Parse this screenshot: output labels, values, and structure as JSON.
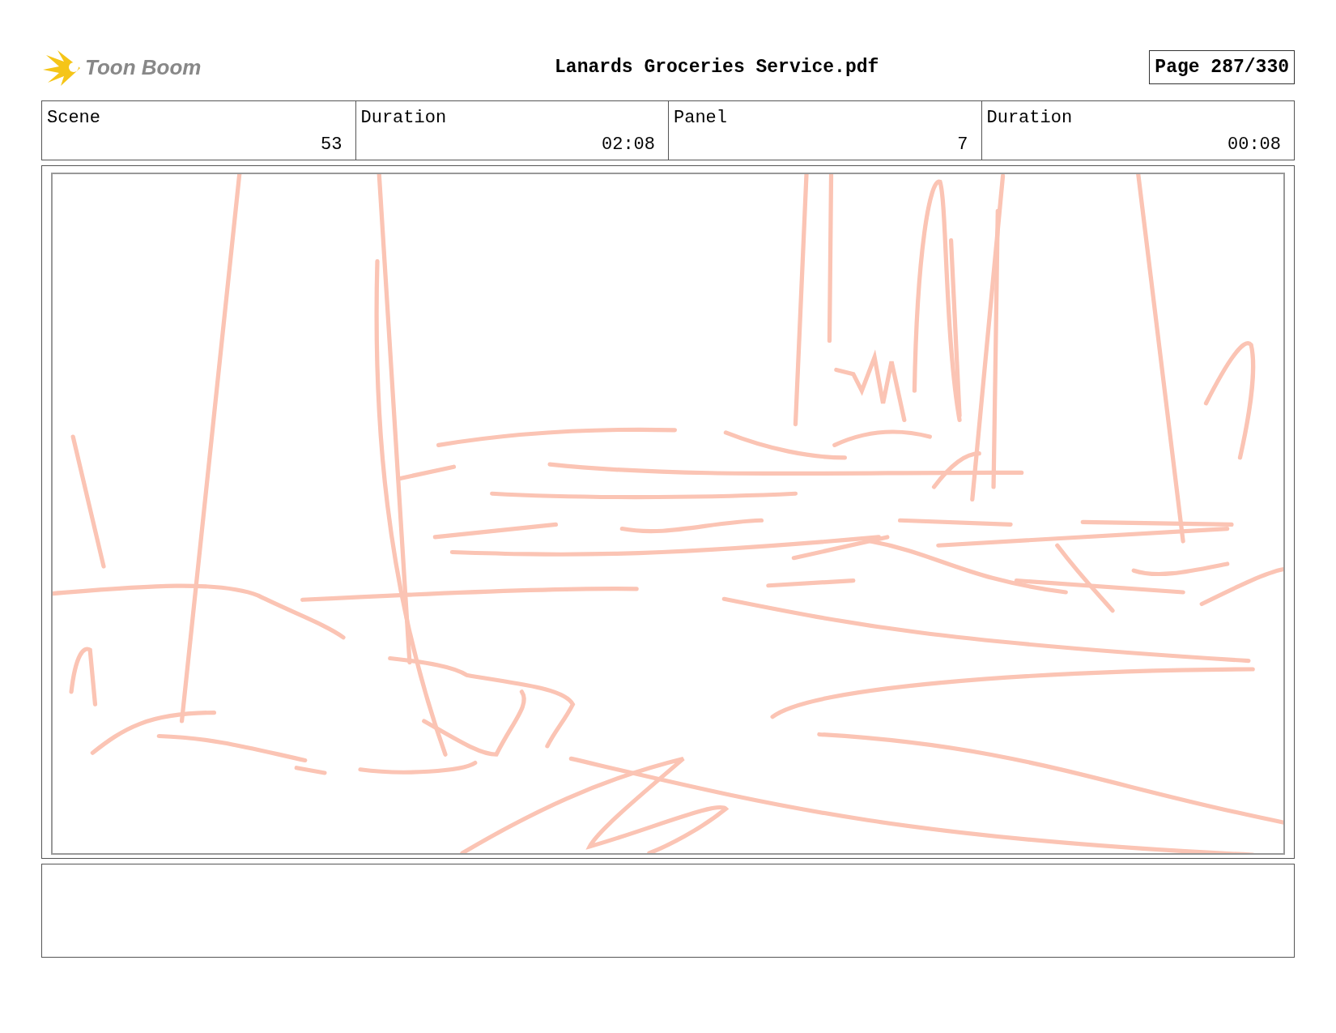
{
  "header": {
    "logo_text": "Toon Boom",
    "title": "Lanards Groceries Service.pdf",
    "page": "Page 287/330"
  },
  "info": [
    {
      "label": "Scene",
      "value": "53"
    },
    {
      "label": "Duration",
      "value": "02:08"
    },
    {
      "label": "Panel",
      "value": "7"
    },
    {
      "label": "Duration",
      "value": "00:08"
    }
  ]
}
